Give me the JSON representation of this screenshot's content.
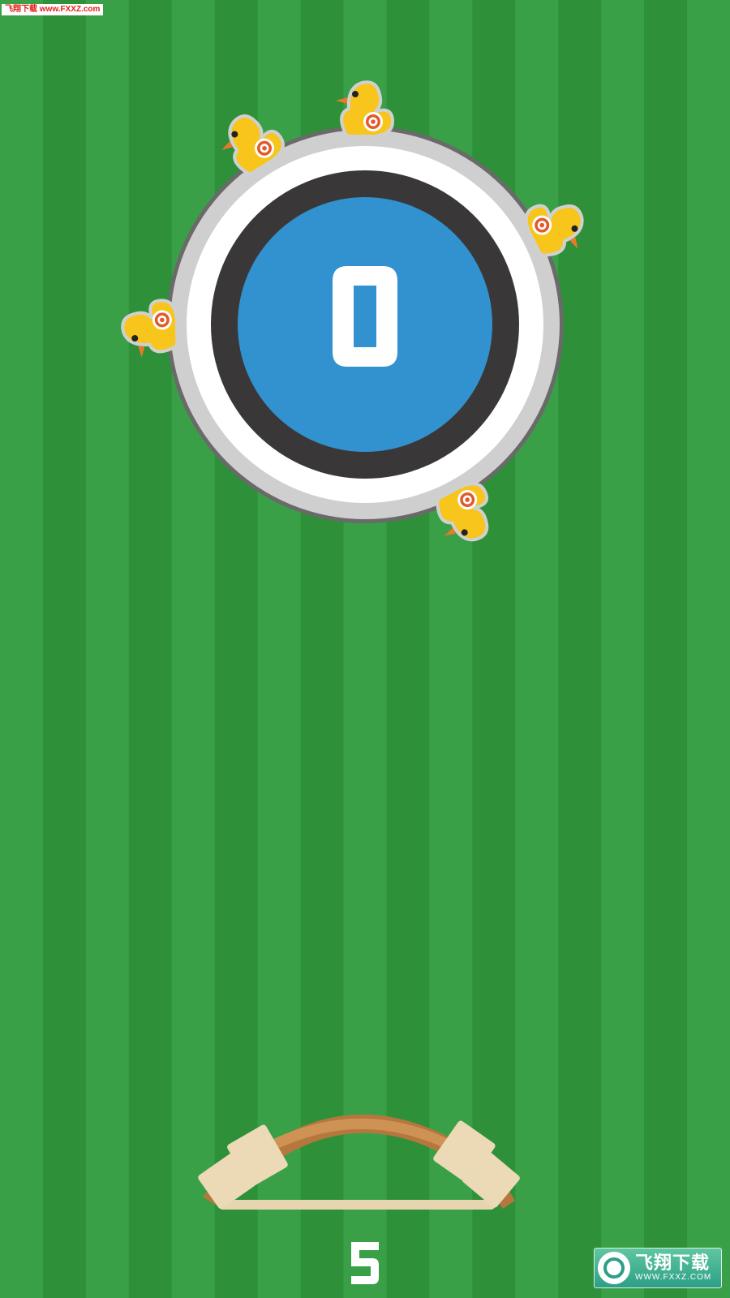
{
  "colors": {
    "grass_light": "#3aa047",
    "grass_dark": "#2e9038",
    "target_outer_edge": "#6a6a6a",
    "target_gray_ring": "#cfcfcf",
    "target_white_ring": "#ffffff",
    "target_dark_ring": "#3a3739",
    "target_center": "#3192cf",
    "duck_body": "#f7c51c",
    "duck_beak": "#e8792b",
    "duck_bullseye": "#e25a2a",
    "bow_wood": "#b5773d",
    "bow_wood_light": "#cf9255",
    "bow_wrap": "#ecd9b5",
    "bow_string": "#e7d4b0",
    "text_white": "#ffffff"
  },
  "watermark_top": "飞翔下载 www.FXXZ.com",
  "hud": {
    "score": "0",
    "arrows_left": "5"
  },
  "ducks": [
    {
      "name": "duck-top",
      "angle_deg": 0,
      "facing": "left"
    },
    {
      "name": "duck-upper-left",
      "angle_deg": -32,
      "facing": "left"
    },
    {
      "name": "duck-right",
      "angle_deg": 63,
      "facing": "right"
    },
    {
      "name": "duck-left",
      "angle_deg": -91,
      "facing": "left"
    },
    {
      "name": "duck-bottom-right",
      "angle_deg": 152,
      "facing": "right"
    }
  ],
  "logo_bottom": {
    "title": "飞翔下载",
    "subtitle": "WWW.FXXZ.COM"
  },
  "icons": {
    "logo": "fxxz-logo-icon",
    "bow": "bow-icon",
    "duck": "duck-target-icon"
  }
}
